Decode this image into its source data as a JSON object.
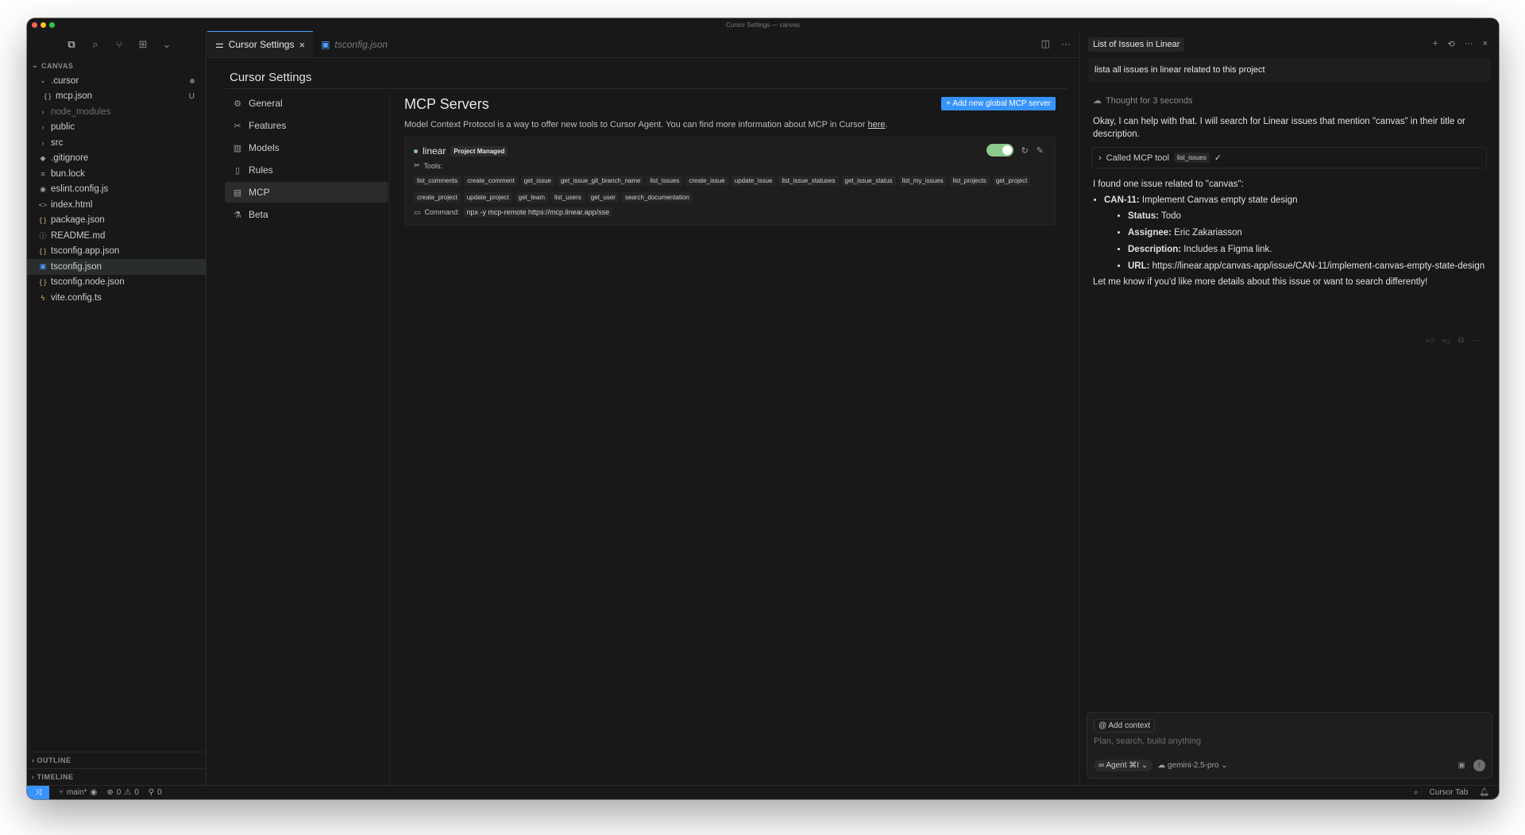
{
  "window": {
    "title": "Cursor Settings — canvas"
  },
  "activity_bar": {
    "icons": [
      "files-icon",
      "search-icon",
      "source-control-icon",
      "extensions-icon",
      "chevron-down-icon"
    ]
  },
  "explorer": {
    "section": "CANVAS",
    "items": [
      {
        "label": ".cursor",
        "type": "folder-open",
        "badge": "dot"
      },
      {
        "label": "mcp.json",
        "type": "json",
        "badge": "U"
      },
      {
        "label": "node_modules",
        "type": "folder",
        "dim": true
      },
      {
        "label": "public",
        "type": "folder"
      },
      {
        "label": "src",
        "type": "folder"
      },
      {
        "label": ".gitignore",
        "type": "git"
      },
      {
        "label": "bun.lock",
        "type": "lock"
      },
      {
        "label": "eslint.config.js",
        "type": "eslint"
      },
      {
        "label": "index.html",
        "type": "html"
      },
      {
        "label": "package.json",
        "type": "json"
      },
      {
        "label": "README.md",
        "type": "info"
      },
      {
        "label": "tsconfig.app.json",
        "type": "json"
      },
      {
        "label": "tsconfig.json",
        "type": "ts",
        "selected": true
      },
      {
        "label": "tsconfig.node.json",
        "type": "json"
      },
      {
        "label": "vite.config.ts",
        "type": "vite"
      }
    ],
    "outline": "OUTLINE",
    "timeline": "TIMELINE"
  },
  "tabs": [
    {
      "label": "Cursor Settings",
      "active": true
    },
    {
      "label": "tsconfig.json",
      "active": false
    }
  ],
  "settings": {
    "title": "Cursor Settings",
    "nav": [
      {
        "label": "General",
        "icon": "gear-icon"
      },
      {
        "label": "Features",
        "icon": "tools-icon"
      },
      {
        "label": "Models",
        "icon": "bar-chart-icon"
      },
      {
        "label": "Rules",
        "icon": "book-icon"
      },
      {
        "label": "MCP",
        "icon": "server-icon",
        "selected": true
      },
      {
        "label": "Beta",
        "icon": "flask-icon"
      }
    ]
  },
  "mcp": {
    "title": "MCP Servers",
    "add_button": "+ Add new global MCP server",
    "description": "Model Context Protocol is a way to offer new tools to Cursor Agent. You can find more information about MCP in Cursor ",
    "description_link": "here",
    "description_end": ".",
    "server": {
      "name": "linear",
      "badge": "Project Managed",
      "enabled": true,
      "tools_label": "Tools:",
      "tools": [
        "list_comments",
        "create_comment",
        "get_issue",
        "get_issue_git_branch_name",
        "list_issues",
        "create_issue",
        "update_issue",
        "list_issue_statuses",
        "get_issue_status",
        "list_my_issues",
        "list_projects",
        "get_project",
        "create_project",
        "update_project",
        "get_team",
        "list_users",
        "get_user",
        "search_documentation"
      ],
      "command_label": "Command:",
      "command": "npx -y mcp-remote https://mcp.linear.app/sse"
    }
  },
  "chat": {
    "tab_title": "List of Issues in Linear",
    "user_message": "lista all issues in linear related to this project",
    "thought": "Thought for 3 seconds",
    "intro": "Okay, I can help with that. I will search for Linear issues that mention \"canvas\" in their title or description.",
    "tool_call_label": "Called MCP tool",
    "tool_call_name": "list_issues",
    "found": "I found one issue related to \"canvas\":",
    "issue_id": "CAN-11:",
    "issue_title": " Implement Canvas empty state design",
    "status_label": "Status:",
    "status_value": " Todo",
    "assignee_label": "Assignee:",
    "assignee_value": " Eric Zakariasson",
    "description_label": "Description:",
    "description_value": " Includes a Figma link.",
    "url_label": "URL:",
    "url_value": " https://linear.app/canvas-app/issue/CAN-11/implement-canvas-empty-state-design",
    "closing": "Let me know if you'd like more details about this issue or want to search differently!",
    "add_context": "Add context",
    "placeholder": "Plan, search, build anything",
    "agent_label": "Agent",
    "agent_shortcut": "⌘I",
    "model": "gemini-2.5-pro"
  },
  "statusbar": {
    "branch": "main*",
    "errors": "0",
    "warnings": "0",
    "ports": "0",
    "cursor_tab": "Cursor Tab"
  }
}
